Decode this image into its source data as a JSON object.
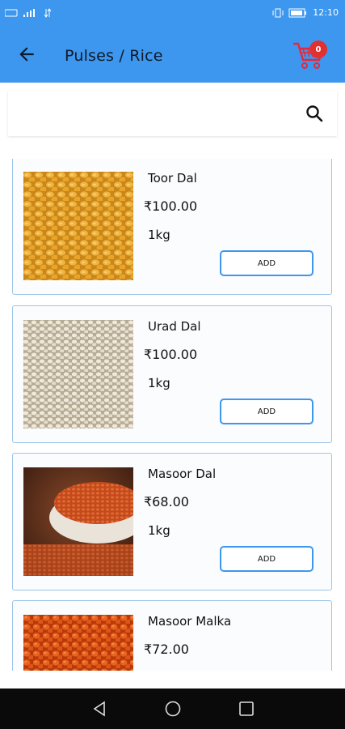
{
  "status_bar": {
    "left_icons": [
      "sim-icon",
      "signal-icon",
      "data-icon"
    ],
    "right_icons": [
      "vibrate-icon",
      "battery-icon"
    ],
    "time": "12:10"
  },
  "app_bar": {
    "title": "Pulses / Rice",
    "cart_count": "0"
  },
  "search": {
    "value": "",
    "placeholder": ""
  },
  "products": [
    {
      "name": "Toor Dal",
      "price": "₹100.00",
      "qty": "1kg",
      "button": "ADD",
      "image": "yellow-lentils"
    },
    {
      "name": "Urad Dal",
      "price": "₹100.00",
      "qty": "1kg",
      "button": "ADD",
      "image": "white-lentils"
    },
    {
      "name": "Masoor Dal",
      "price": "₹68.00",
      "qty": "1kg",
      "button": "ADD",
      "image": "red-lentils-bowl"
    },
    {
      "name": "Masoor Malka",
      "price": "₹72.00",
      "qty": "",
      "button": "",
      "image": "orange-lentils"
    }
  ],
  "colors": {
    "primary": "#3d97ee",
    "card_border": "#9cc4e8",
    "badge": "#e03030"
  }
}
